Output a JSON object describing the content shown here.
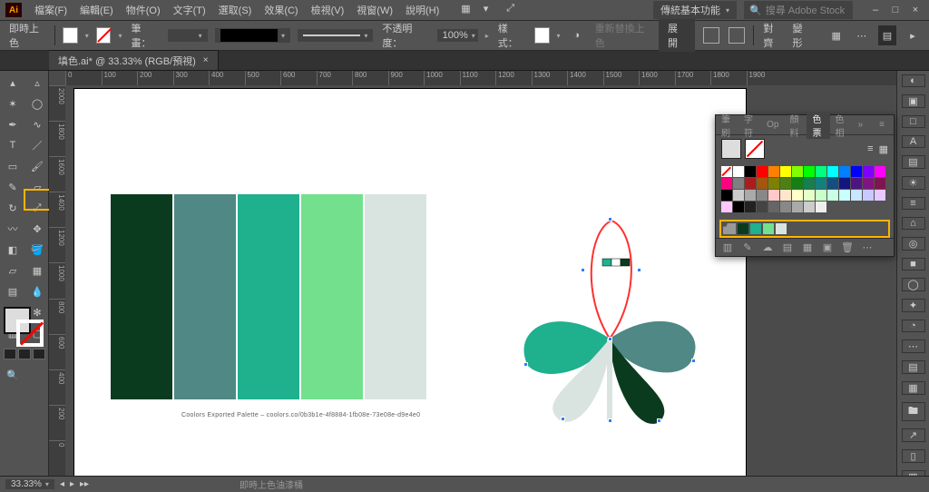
{
  "app": {
    "logo": "Ai"
  },
  "menu": [
    "檔案(F)",
    "編輯(E)",
    "物件(O)",
    "文字(T)",
    "選取(S)",
    "效果(C)",
    "檢視(V)",
    "視窗(W)",
    "說明(H)"
  ],
  "menu_extras": [
    "▦",
    "▾",
    "⤢"
  ],
  "workspace": "傳統基本功能",
  "search_placeholder": "搜尋 Adobe Stock",
  "window_buttons": [
    "–",
    "□",
    "×"
  ],
  "options": {
    "label": "即時上色",
    "stroke_label": "筆畫：",
    "stroke_weight": "",
    "opacity_label": "不透明度：",
    "opacity_value": "100%",
    "style_label": "樣式：",
    "recolor_label": "重新替換上色",
    "expand_label": "展開",
    "align_label": "對齊",
    "transform_label": "變形",
    "panel_toggle": "▤"
  },
  "document_tab": {
    "title": "填色.ai* @ 33.33% (RGB/預視)",
    "close": "×"
  },
  "ruler_marks_h": [
    "0",
    "100",
    "200",
    "300",
    "400",
    "500",
    "600",
    "700",
    "800",
    "900",
    "1000",
    "1100",
    "1200",
    "1300",
    "1400",
    "1500",
    "1600",
    "1700",
    "1800",
    "1900"
  ],
  "ruler_marks_v": [
    "2000",
    "1800",
    "1600",
    "1400",
    "1200",
    "1000",
    "800",
    "600",
    "400",
    "200",
    "0"
  ],
  "palette_colors": [
    "#0b3b1e",
    "#4f8884",
    "#1fb08e",
    "#73e08e",
    "#d9e4e0"
  ],
  "palette_caption": "Coolors Exported Palette – coolors.co/0b3b1e-4f8884-1fb08e-73e08e-d9e4e0",
  "swatch_panel": {
    "tabs": [
      "筆刷",
      "字符",
      "Op",
      "顏料",
      "色票",
      "色相"
    ],
    "active_tab": 4,
    "view_icons": [
      "≡",
      "▦"
    ],
    "grid_colors": [
      "#ffffff",
      "#000000",
      "#ff0000",
      "#ff8000",
      "#ffff00",
      "#80ff00",
      "#00ff00",
      "#00ff80",
      "#00ffff",
      "#0080ff",
      "#0000ff",
      "#8000ff",
      "#ff00ff",
      "#ff0080",
      "#7f7f7f",
      "#aa1d1d",
      "#a3560d",
      "#7f7f00",
      "#4e7f15",
      "#157f15",
      "#157f4e",
      "#157f7f",
      "#154e7f",
      "#15157f",
      "#4e157f",
      "#7f157f",
      "#7f154e",
      "#000000",
      "#cccccc",
      "#aaaaaa",
      "#888888",
      "#ffc9c9",
      "#ffe5c9",
      "#ffffc9",
      "#e5ffc9",
      "#c9ffc9",
      "#c9ffe5",
      "#c9ffff",
      "#c9e5ff",
      "#c9c9ff",
      "#e5c9ff",
      "#ffc9ff",
      "#000000",
      "#222222",
      "#444444",
      "#666666",
      "#888888",
      "#aaaaaa",
      "#cccccc",
      "#eeeeee"
    ],
    "custom_group": [
      "#0b3b1e",
      "#1fb08e",
      "#73e08e",
      "#d9e4e0"
    ],
    "footer_icons": [
      "▥",
      "✎",
      "☁",
      "▤",
      "▦",
      "▣",
      "🗑",
      "⋯"
    ]
  },
  "right_strip": [
    "◐",
    "▣",
    "□",
    "A",
    "▤",
    "☀",
    "≡",
    "⌂",
    "◎",
    "■",
    "◯",
    "✦",
    "◔",
    "⋯",
    "▤",
    "▦",
    "🖿",
    "↗",
    "▯",
    "▥"
  ],
  "status": {
    "zoom": "33.33%",
    "tool_hint": "即時上色油漆桶",
    "nav_icons": [
      "◂",
      "▸",
      "▸▸"
    ]
  },
  "tools": [
    "selection",
    "direct-selection",
    "magic-wand",
    "lasso",
    "pen",
    "curvature",
    "type",
    "line",
    "rectangle",
    "paintbrush",
    "shaper",
    "eraser",
    "rotate",
    "scale",
    "width",
    "free-transform",
    "shape-builder",
    "live-paint",
    "perspective",
    "mesh",
    "gradient",
    "eyedropper",
    "blend",
    "symbol-spray",
    "column-graph",
    "artboard",
    "slice",
    "hand",
    "zoom",
    ""
  ]
}
